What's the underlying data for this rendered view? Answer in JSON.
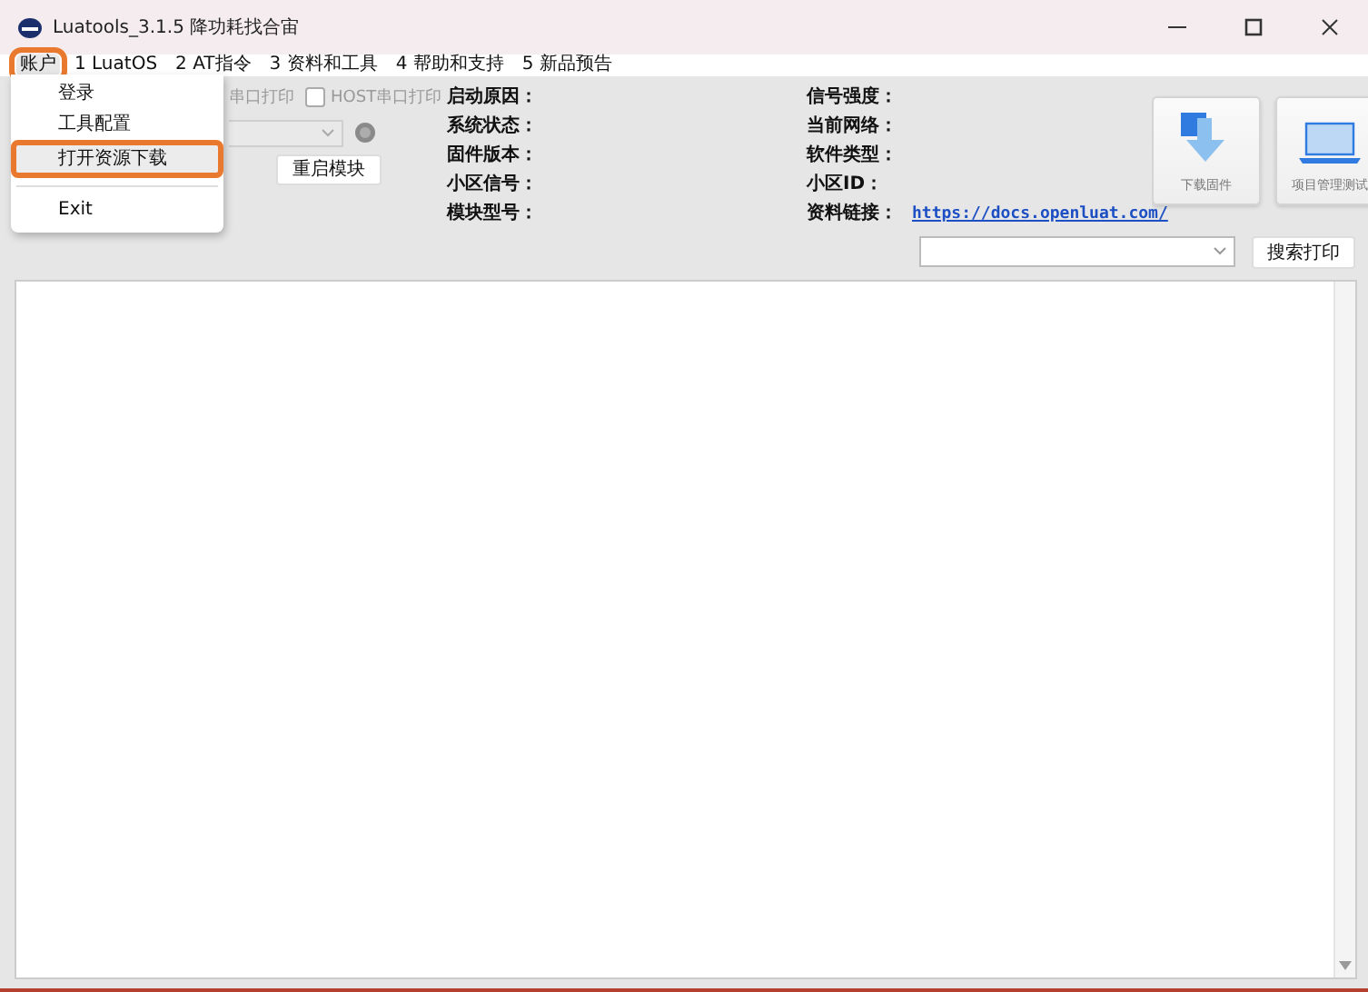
{
  "window": {
    "title": "Luatools_3.1.5 降功耗找合宙"
  },
  "menu_bar": [
    {
      "label": "账户",
      "selected": true,
      "highlighted": true
    },
    {
      "label": "1 LuatOS",
      "selected": false,
      "highlighted": false
    },
    {
      "label": "2 AT指令",
      "selected": false,
      "highlighted": false
    },
    {
      "label": "3 资料和工具",
      "selected": false,
      "highlighted": false
    },
    {
      "label": "4 帮助和支持",
      "selected": false,
      "highlighted": false
    },
    {
      "label": "5 新品预告",
      "selected": false,
      "highlighted": false
    }
  ],
  "account_menu": [
    {
      "kind": "item",
      "label": "登录",
      "hovered": false,
      "highlighted": false
    },
    {
      "kind": "item",
      "label": "工具配置",
      "hovered": false,
      "highlighted": false
    },
    {
      "kind": "item",
      "label": "打开资源下载",
      "hovered": true,
      "highlighted": true
    },
    {
      "kind": "separator"
    },
    {
      "kind": "item",
      "label": "Exit",
      "hovered": false,
      "highlighted": false
    }
  ],
  "print_options": [
    {
      "kind": "cut",
      "label": "串口打印"
    },
    {
      "kind": "checkbox",
      "label": "HOST串口打印",
      "checked": false
    }
  ],
  "status_light": {
    "on": false
  },
  "module_buttons": [
    {
      "label": "重启模块"
    }
  ],
  "info_left": [
    {
      "label": "启动原因："
    },
    {
      "label": "系统状态："
    },
    {
      "label": "固件版本："
    },
    {
      "label": "小区信号："
    },
    {
      "label": "模块型号："
    }
  ],
  "info_right": [
    {
      "label": "信号强度："
    },
    {
      "label": "当前网络："
    },
    {
      "label": "软件类型："
    },
    {
      "label": "小区ID："
    },
    {
      "label": "资料链接：",
      "link": "https://docs.openluat.com/"
    }
  ],
  "big_buttons": [
    {
      "kind": "download",
      "label": "下载固件"
    },
    {
      "kind": "laptop",
      "label": "项目管理测试"
    }
  ],
  "search": {
    "button": "搜索打印"
  }
}
